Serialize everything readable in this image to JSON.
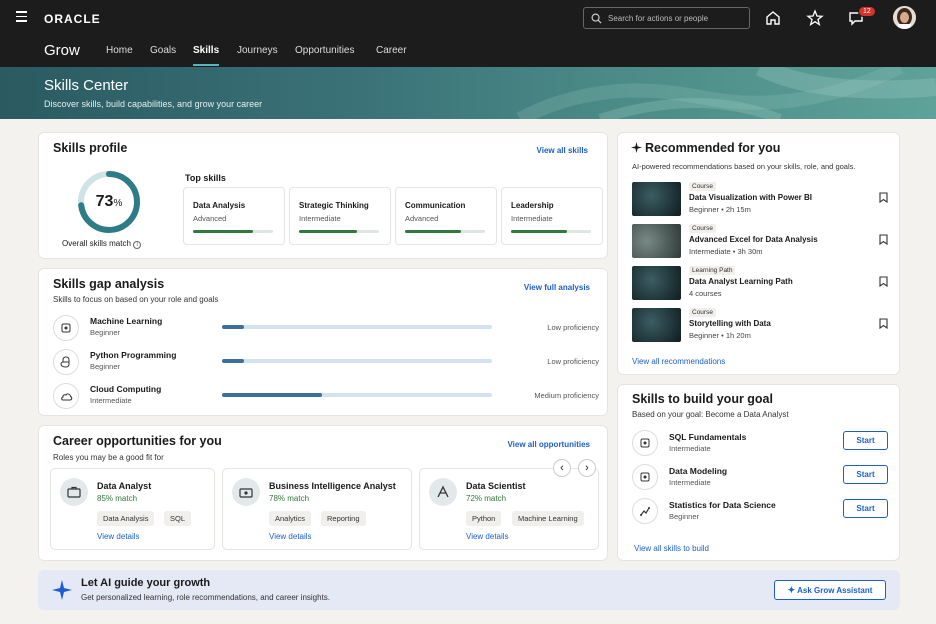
{
  "topbar": {
    "logo": "ORACLE",
    "search_placeholder": "Search for actions or people",
    "notifications_count": "12"
  },
  "nav": {
    "app": "Grow",
    "items": [
      "Home",
      "Goals",
      "Skills",
      "Journeys",
      "Opportunities",
      "Career"
    ],
    "active": "Skills"
  },
  "hero": {
    "title": "Skills Center",
    "subtitle": "Discover skills, build capabilities, and grow your career"
  },
  "skills_profile": {
    "title": "Skills profile",
    "view_all": "View all skills",
    "percent": "73",
    "percent_sign": "%",
    "percent_value": 73,
    "overall_label": "Overall skills match",
    "top_skills_label": "Top skills",
    "top_skills": [
      {
        "name": "Data Analysis",
        "level": "Advanced",
        "progress": 0.75
      },
      {
        "name": "Strategic Thinking",
        "level": "Intermediate",
        "progress": 0.72
      },
      {
        "name": "Communication",
        "level": "Advanced",
        "progress": 0.7
      },
      {
        "name": "Leadership",
        "level": "Intermediate",
        "progress": 0.7
      }
    ]
  },
  "gap": {
    "title": "Skills gap analysis",
    "subtitle": "Skills to focus on based on your role and goals",
    "view_full": "View full analysis",
    "items": [
      {
        "name": "Machine Learning",
        "level": "Beginner",
        "proficiency": "Low proficiency",
        "progress": 0.08
      },
      {
        "name": "Python Programming",
        "level": "Beginner",
        "proficiency": "Low proficiency",
        "progress": 0.08
      },
      {
        "name": "Cloud Computing",
        "level": "Intermediate",
        "proficiency": "Medium proficiency",
        "progress": 0.37
      }
    ]
  },
  "career": {
    "title": "Career opportunities for you",
    "subtitle": "Roles you may be a good fit for",
    "view_all": "View all opportunities",
    "view_details": "View details",
    "roles": [
      {
        "title": "Data Analyst",
        "match": "85% match",
        "tags": [
          "Data Analysis",
          "SQL"
        ]
      },
      {
        "title": "Business Intelligence Analyst",
        "match": "78% match",
        "tags": [
          "Analytics",
          "Reporting"
        ]
      },
      {
        "title": "Data Scientist",
        "match": "72% match",
        "tags": [
          "Python",
          "Machine Learning"
        ]
      }
    ]
  },
  "recommended": {
    "title": "Recommended for you",
    "subtitle": "AI-powered recommendations based on your skills, role, and goals.",
    "view_all": "View all recommendations",
    "items": [
      {
        "type": "Course",
        "title": "Data Visualization with Power BI",
        "level": "Beginner",
        "meta": "2h 15m"
      },
      {
        "type": "Course",
        "title": "Advanced Excel for Data Analysis",
        "level": "Intermediate",
        "meta": "3h 30m"
      },
      {
        "type": "Learning Path",
        "title": "Data Analyst Learning Path",
        "level": "",
        "meta": "4 courses"
      },
      {
        "type": "Course",
        "title": "Storytelling with Data",
        "level": "Beginner",
        "meta": "1h 20m"
      }
    ]
  },
  "goal": {
    "title": "Skills to build your goal",
    "subtitle": "Based on your goal: Become a Data Analyst",
    "start_label": "Start",
    "view_all": "View all skills to build",
    "items": [
      {
        "name": "SQL Fundamentals",
        "level": "Intermediate"
      },
      {
        "name": "Data Modeling",
        "level": "Intermediate"
      },
      {
        "name": "Statistics for Data Science",
        "level": "Beginner"
      }
    ]
  },
  "ai_banner": {
    "title": "Let AI guide your growth",
    "subtitle": "Get personalized learning, role recommendations, and career insights.",
    "button": "Ask Grow Assistant"
  }
}
